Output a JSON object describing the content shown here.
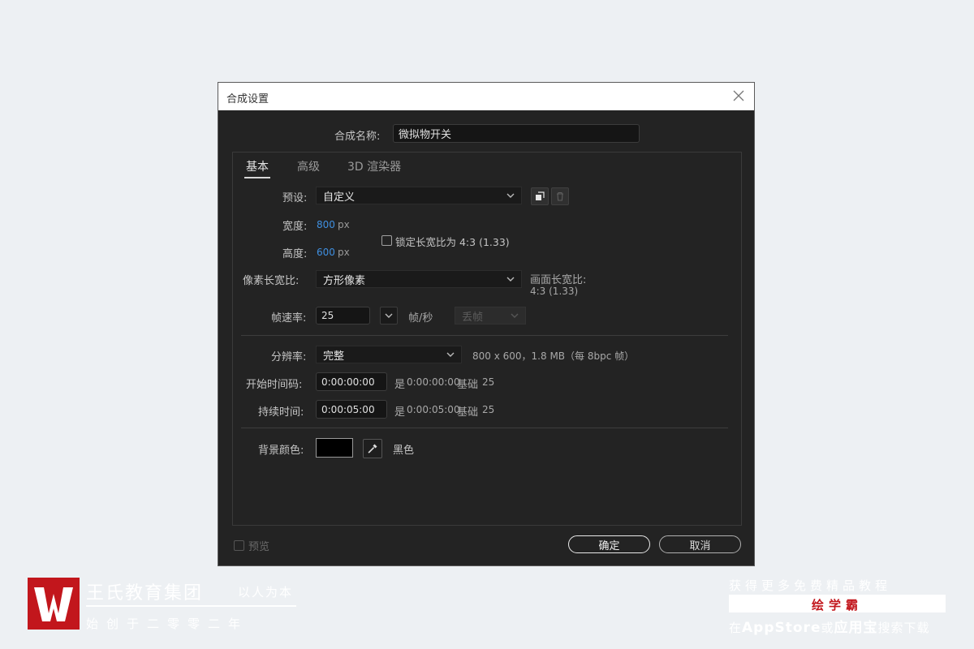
{
  "dialog": {
    "title": "合成设置",
    "name_label": "合成名称:",
    "name_value": "微拟物开关",
    "tabs": [
      {
        "label": "基本",
        "active": true
      },
      {
        "label": "高级",
        "active": false
      },
      {
        "label": "3D 渲染器",
        "active": false
      }
    ],
    "preset": {
      "label": "预设:",
      "value": "自定义"
    },
    "width": {
      "label": "宽度:",
      "value": "800",
      "unit": "px"
    },
    "height": {
      "label": "高度:",
      "value": "600",
      "unit": "px"
    },
    "lock_aspect": {
      "label": "锁定长宽比为 4:3 (1.33)",
      "checked": false
    },
    "pixel_aspect": {
      "label": "像素长宽比:",
      "value": "方形像素"
    },
    "frame_aspect": {
      "label": "画面长宽比:",
      "value": "4:3 (1.33)"
    },
    "frame_rate": {
      "label": "帧速率:",
      "value": "25",
      "unit": "帧/秒",
      "drop_frame": "丢帧"
    },
    "resolution": {
      "label": "分辨率:",
      "value": "完整",
      "info": "800 x 600，1.8 MB（每 8bpc 帧）"
    },
    "start_timecode": {
      "label": "开始时间码:",
      "value": "0:00:00:00",
      "note_prefix": "是",
      "note_time": "0:00:00:00",
      "note_base": "基础",
      "note_base_value": "25"
    },
    "duration": {
      "label": "持续时间:",
      "value": "0:00:05:00",
      "note_prefix": "是",
      "note_time": "0:00:05:00",
      "note_base": "基础",
      "note_base_value": "25"
    },
    "bg_color": {
      "label": "背景颜色:",
      "name": "黑色",
      "hex": "#000000"
    },
    "preview": {
      "label": "预览",
      "checked": false
    },
    "ok_label": "确定",
    "cancel_label": "取消"
  },
  "watermark": {
    "org_name": "王氏教育集团",
    "slogan": "以人为本",
    "founded": "始创于二零零二年",
    "right_line1": "获得更多免费精品教程",
    "brand": "绘学霸",
    "right_line2_a": "在",
    "right_line2_b": "AppStore",
    "right_line2_c": "或",
    "right_line2_d": "应用宝",
    "right_line2_e": "搜索下载"
  }
}
